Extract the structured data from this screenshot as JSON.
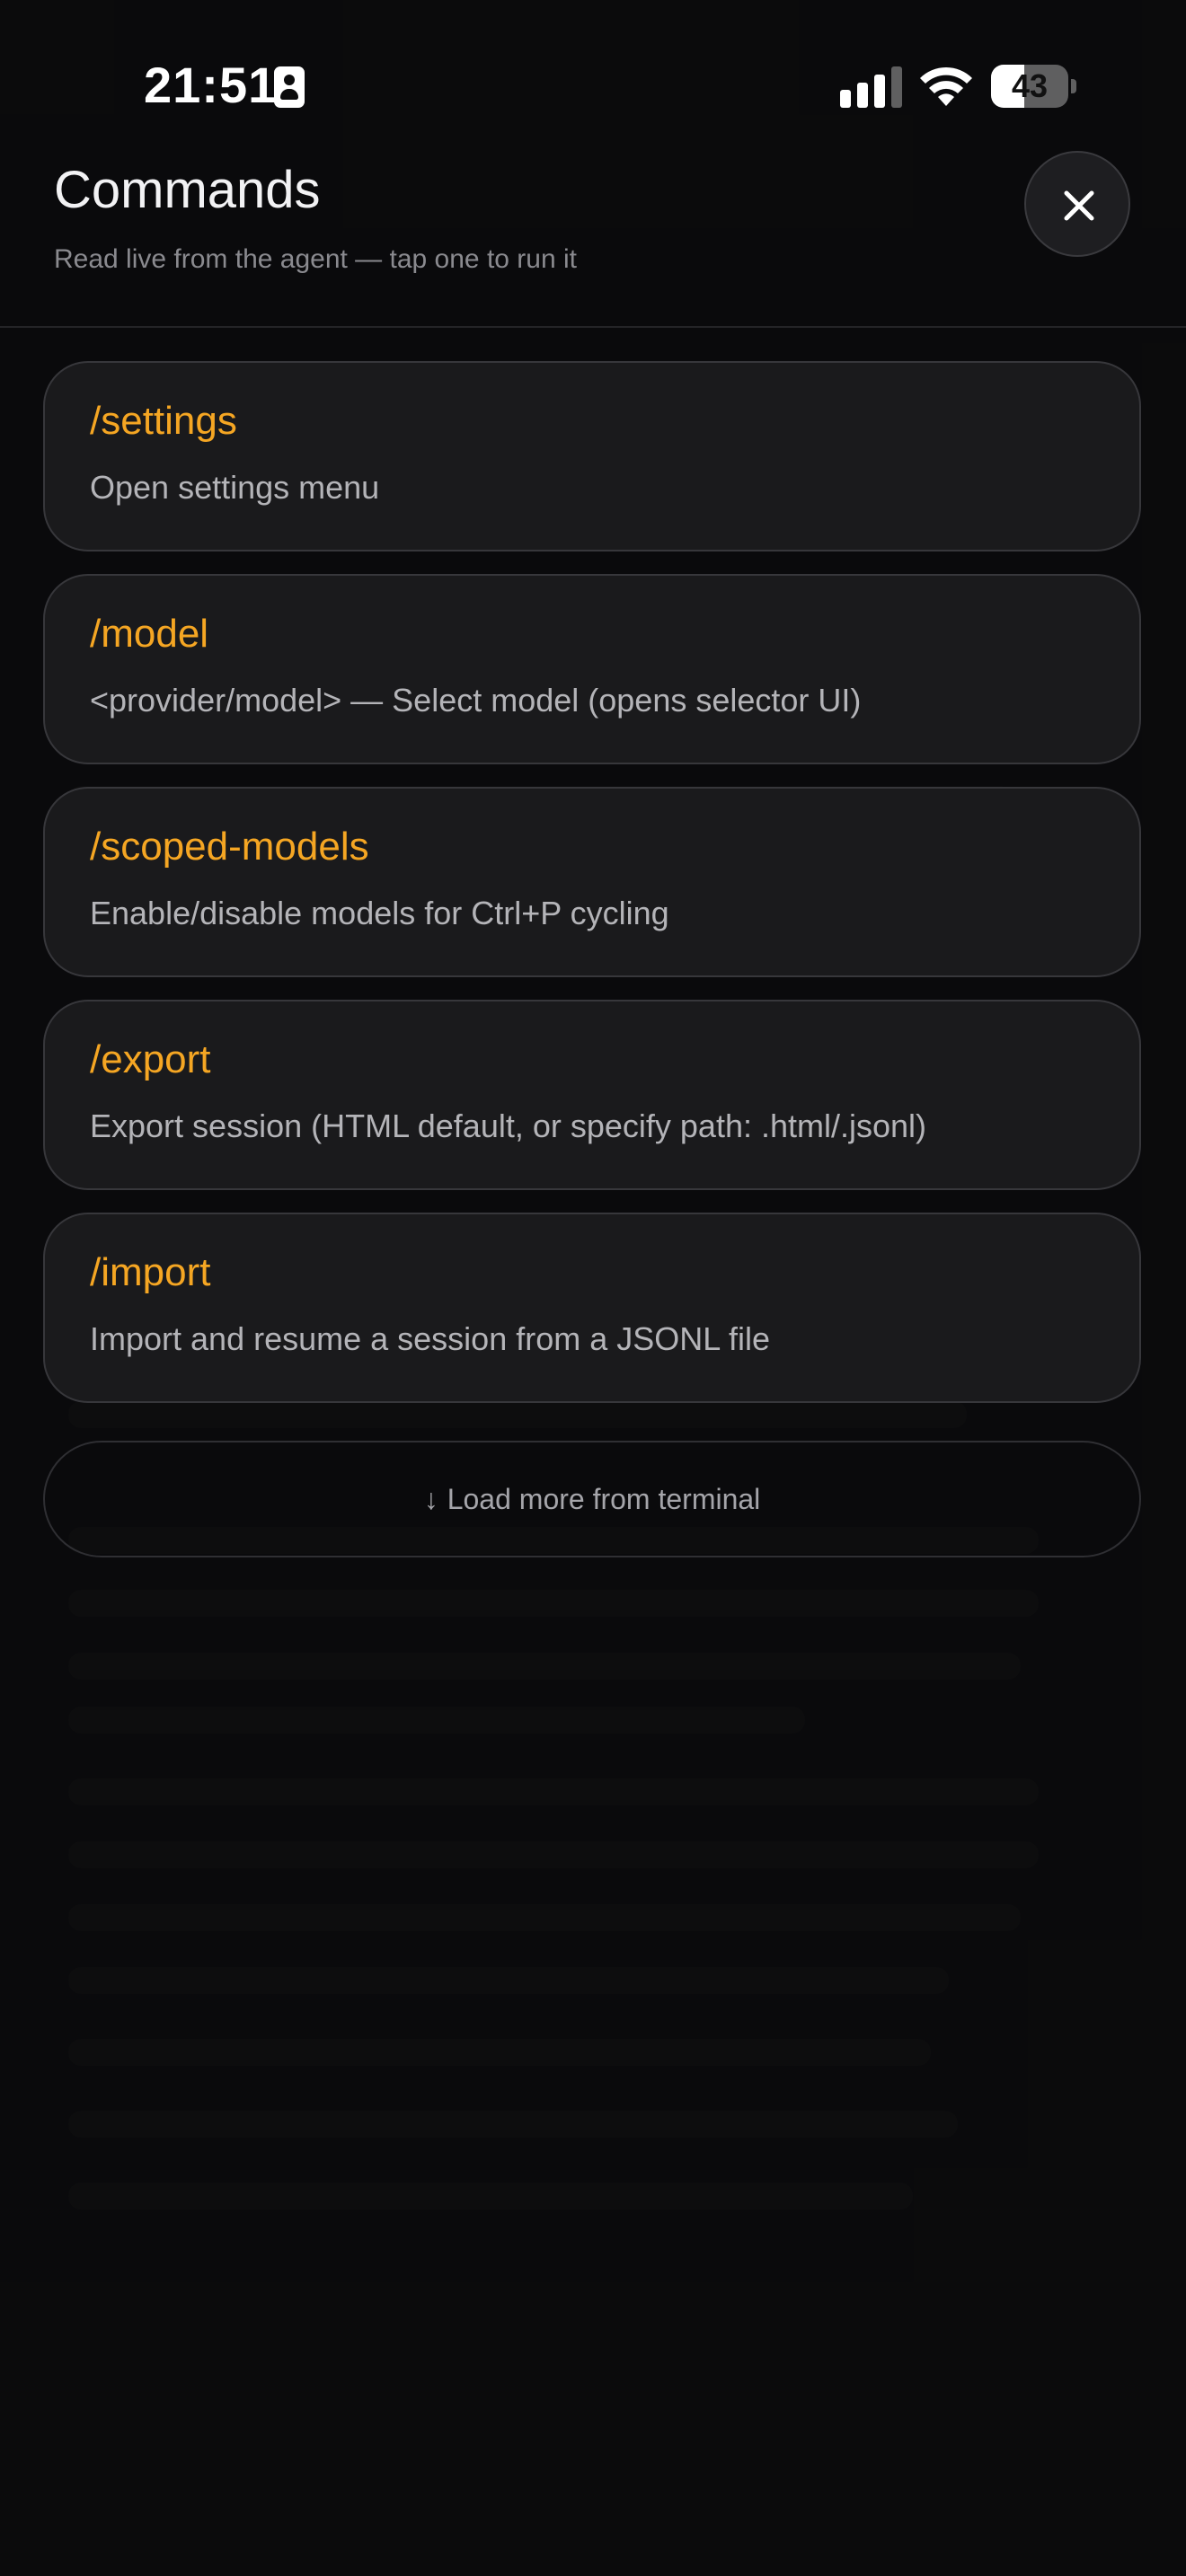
{
  "status_bar": {
    "time": "21:51",
    "battery": "43",
    "battery_level": 0.43
  },
  "header": {
    "title": "Commands",
    "subtitle": "Read live from the agent — tap one to run it"
  },
  "commands": [
    {
      "name": "/settings",
      "description": "Open settings menu"
    },
    {
      "name": "/model",
      "description": "<provider/model> — Select model (opens selector UI)"
    },
    {
      "name": "/scoped-models",
      "description": "Enable/disable models for Ctrl+P cycling"
    },
    {
      "name": "/export",
      "description": "Export session (HTML default, or specify path: .html/.jsonl)"
    },
    {
      "name": "/import",
      "description": "Import and resume a session from a JSONL file"
    }
  ],
  "load_more": {
    "arrow": "↓",
    "label": "Load more from terminal"
  },
  "icons": {
    "person-card": "id-icon",
    "signal": "signal-icon",
    "wifi": "wifi-icon",
    "battery": "battery-icon",
    "close": "close-icon"
  },
  "colors": {
    "accent": "#f5a623",
    "background": "#0b0b0c",
    "card": "#1a1a1c"
  }
}
